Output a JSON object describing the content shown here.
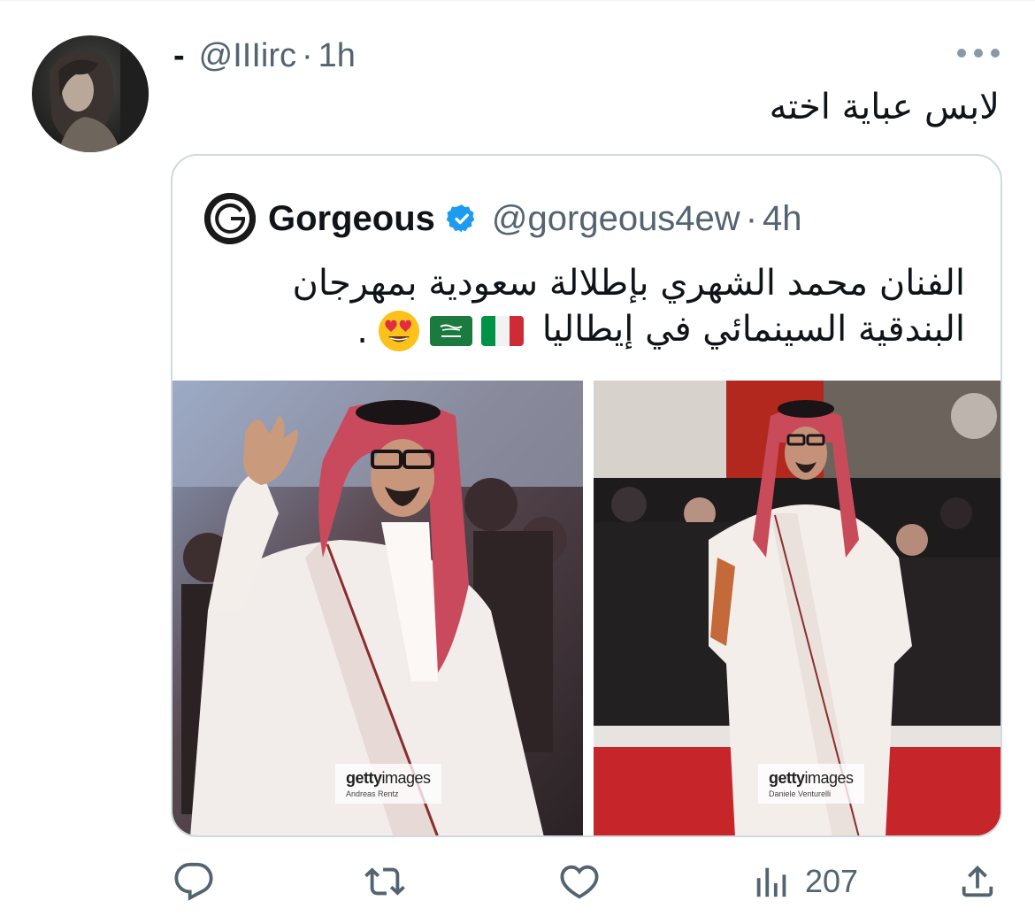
{
  "tweet": {
    "display_name": "-",
    "handle": "@IIIirc",
    "separator": "·",
    "timestamp": "1h",
    "text": "لابس عباية اخته",
    "avatar_icon": "profile-photo"
  },
  "quote": {
    "display_name": "Gorgeous",
    "verified_icon": "verified-badge-icon",
    "handle": "@gorgeous4ew",
    "separator": "·",
    "timestamp": "4h",
    "text_line1": "الفنان محمد الشهري بإطلالة سعودية بمهرجان",
    "text_line2": "البندقية السينمائي في إيطاليا",
    "text_end": ".",
    "emojis": [
      "italy-flag",
      "saudi-flag",
      "heart-eyes-face"
    ],
    "photos": [
      {
        "watermark_brand": "gettyimages",
        "credit": "Andreas Rentz"
      },
      {
        "watermark_brand": "gettyimages",
        "credit": "Daniele Venturelli"
      }
    ]
  },
  "actions": {
    "reply_icon": "reply-icon",
    "retweet_icon": "retweet-icon",
    "like_icon": "like-icon",
    "views_icon": "views-icon",
    "views_count": "207",
    "share_icon": "share-icon"
  },
  "colors": {
    "text": "#0f1419",
    "secondary": "#536471",
    "border": "#cfd9de",
    "verified": "#1d9bf0"
  }
}
